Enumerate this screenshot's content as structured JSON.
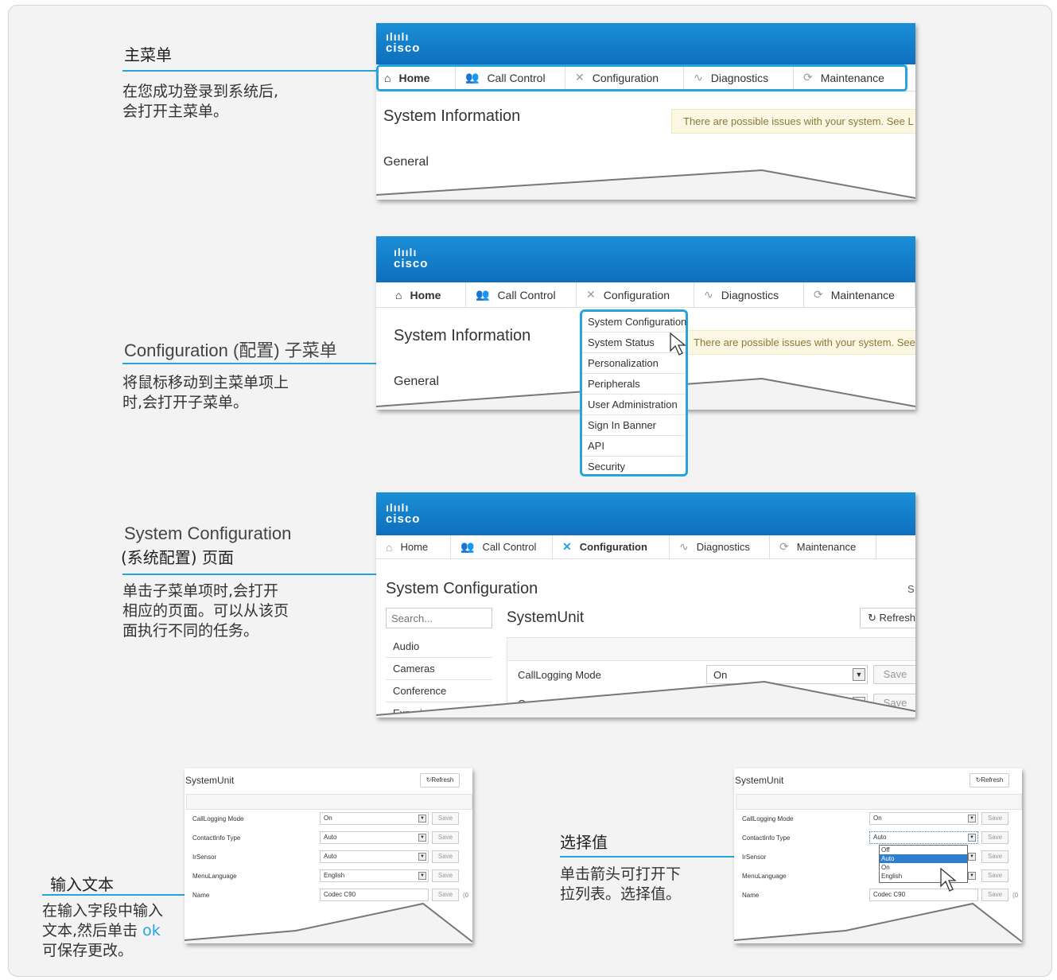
{
  "brand": {
    "bars": "ılıılı",
    "word": "cisco",
    "accent": "#27a3dd",
    "banner": "#1380cc"
  },
  "nav": {
    "home": "Home",
    "call_control": "Call Control",
    "configuration": "Configuration",
    "diagnostics": "Diagnostics",
    "maintenance": "Maintenance"
  },
  "section1": {
    "title": "主菜单",
    "desc1": "在您成功登录到系统后,",
    "desc2": "会打开主菜单。",
    "page_title": "System Information",
    "warning": "There are possible issues with your system. See L",
    "general": "General"
  },
  "section2": {
    "title": "Configuration (配置) 子菜单",
    "desc1": "将鼠标移动到主菜单项上",
    "desc2": "时,会打开子菜单。",
    "page_title": "System Information",
    "warning": "There are possible issues with your system. See",
    "general": "General",
    "submenu": [
      "System Configuration",
      "System Status",
      "Personalization",
      "Peripherals",
      "User Administration",
      "Sign In Banner",
      "API",
      "Security"
    ]
  },
  "section3": {
    "title_en": "System Configuration",
    "title_cn": "(系统配置) 页面",
    "desc1": "单击子菜单项时,会打开",
    "desc2": "相应的页面。可以从该页",
    "desc3": "面执行不同的任务。",
    "page_title": "System Configuration",
    "corner": "S",
    "search_placeholder": "Search...",
    "unit": "SystemUnit",
    "refresh": "Refresh",
    "side": [
      "Audio",
      "Cameras",
      "Conference",
      "Experimental"
    ],
    "row1_label": "CallLogging Mode",
    "row1_value": "On",
    "row2_label": "ContactInfo Type",
    "save": "Save"
  },
  "section4": {
    "title": "输入文本",
    "desc1": "在输入字段中输入",
    "desc2_pre": "文本,然后单击 ",
    "desc2_ok": "ok",
    "desc3": "可保存更改。",
    "unit": "SystemUnit",
    "refresh": "Refresh",
    "save": "Save",
    "suffix": "(0",
    "rows": [
      {
        "label": "CallLogging Mode",
        "value": "On"
      },
      {
        "label": "ContactInfo Type",
        "value": "Auto"
      },
      {
        "label": "IrSensor",
        "value": "Auto"
      },
      {
        "label": "MenuLanguage",
        "value": "English"
      },
      {
        "label": "Name",
        "value": "Codec C90"
      }
    ]
  },
  "section5": {
    "title": "选择值",
    "desc1": "单击箭头可打开下",
    "desc2": "拉列表。选择值。",
    "unit": "SystemUnit",
    "refresh": "Refresh",
    "save": "Save",
    "suffix": "(0",
    "rows": [
      {
        "label": "CallLogging Mode",
        "value": "On"
      },
      {
        "label": "ContactInfo Type",
        "value": "Auto"
      },
      {
        "label": "IrSensor",
        "value": ""
      },
      {
        "label": "MenuLanguage",
        "value": "English"
      },
      {
        "label": "Name",
        "value": "Codec C90"
      }
    ],
    "options": [
      "Off",
      "Auto",
      "On",
      "English"
    ]
  }
}
